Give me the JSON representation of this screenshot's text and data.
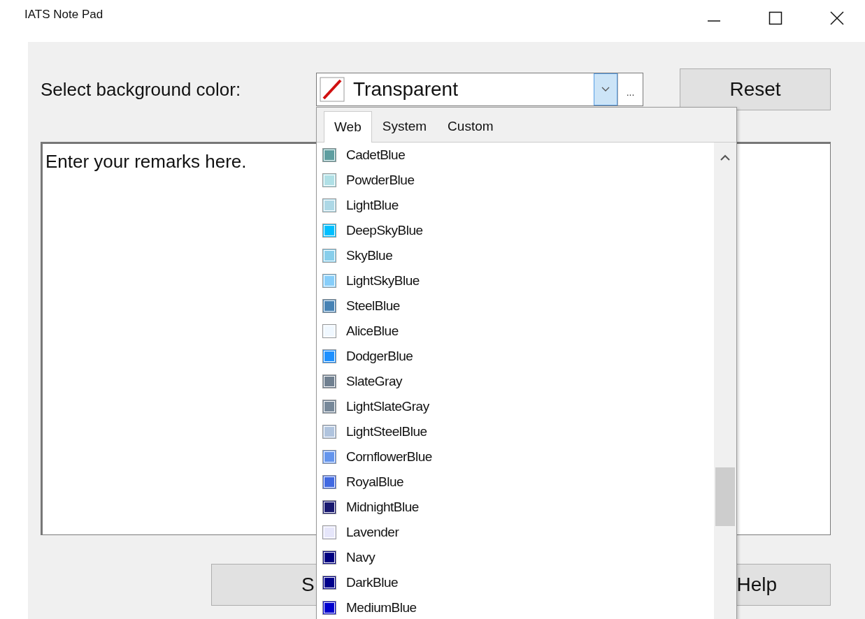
{
  "window": {
    "title": "IATS Note Pad"
  },
  "label": "Select background color:",
  "combo": {
    "value": "Transparent",
    "more": "..."
  },
  "reset_button": "Reset",
  "remarks": {
    "value": "Enter your remarks here."
  },
  "bottom_buttons": [
    "S",
    "Help"
  ],
  "dropdown": {
    "tabs": [
      {
        "label": "Web",
        "selected": true
      },
      {
        "label": "System",
        "selected": false
      },
      {
        "label": "Custom",
        "selected": false
      }
    ],
    "items": [
      {
        "name": "CadetBlue",
        "color": "#5f9ea0"
      },
      {
        "name": "PowderBlue",
        "color": "#b0e0e6"
      },
      {
        "name": "LightBlue",
        "color": "#add8e6"
      },
      {
        "name": "DeepSkyBlue",
        "color": "#00bfff"
      },
      {
        "name": "SkyBlue",
        "color": "#87ceeb"
      },
      {
        "name": "LightSkyBlue",
        "color": "#87cefa"
      },
      {
        "name": "SteelBlue",
        "color": "#4682b4"
      },
      {
        "name": "AliceBlue",
        "color": "#f0f8ff"
      },
      {
        "name": "DodgerBlue",
        "color": "#1e90ff"
      },
      {
        "name": "SlateGray",
        "color": "#708090"
      },
      {
        "name": "LightSlateGray",
        "color": "#778899"
      },
      {
        "name": "LightSteelBlue",
        "color": "#b0c4de"
      },
      {
        "name": "CornflowerBlue",
        "color": "#6495ed"
      },
      {
        "name": "RoyalBlue",
        "color": "#4169e1"
      },
      {
        "name": "MidnightBlue",
        "color": "#191970"
      },
      {
        "name": "Lavender",
        "color": "#e6e6fa"
      },
      {
        "name": "Navy",
        "color": "#000080"
      },
      {
        "name": "DarkBlue",
        "color": "#00008b"
      },
      {
        "name": "MediumBlue",
        "color": "#0000cd"
      }
    ]
  }
}
